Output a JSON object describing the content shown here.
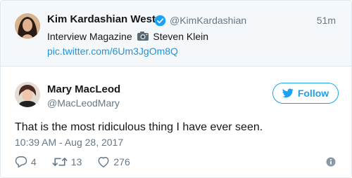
{
  "parent_tweet": {
    "display_name": "Kim Kardashian West",
    "handle": "@KimKardashian",
    "time": "51m",
    "text_before": "Interview Magazine",
    "text_after": "Steven Klein",
    "link": "pic.twitter.com/6Um3JgOm8Q",
    "icons": [
      "verified-badge-icon",
      "camera-icon"
    ]
  },
  "tweet": {
    "display_name": "Mary MacLeod",
    "handle": "@MacLeodMary",
    "follow_label": "Follow",
    "text": "That is the most ridiculous thing I have ever seen.",
    "timestamp": "10:39 AM - Aug 28, 2017",
    "replies": "4",
    "retweets": "13",
    "likes": "276",
    "icons": [
      "twitter-bird-icon",
      "reply-icon",
      "retweet-icon",
      "like-icon",
      "info-icon"
    ]
  },
  "colors": {
    "accent": "#1da1f2",
    "link": "#1b95e0",
    "muted": "#657786",
    "text": "#14171a",
    "parent_bg": "#f5f8fa",
    "border": "#e1e8ed"
  }
}
